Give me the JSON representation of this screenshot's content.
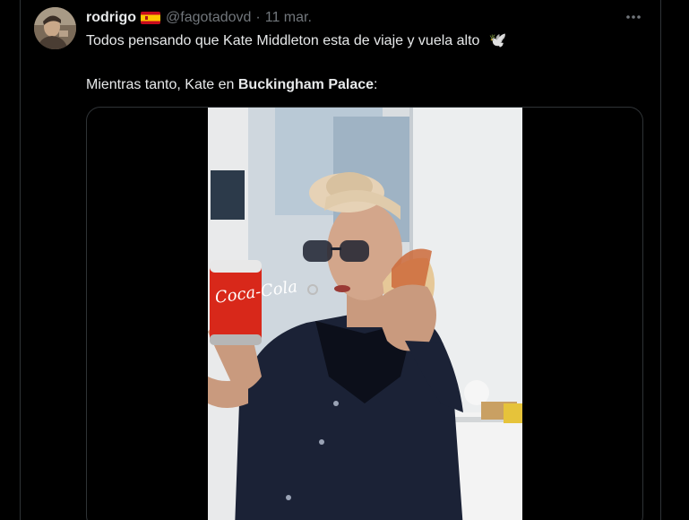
{
  "tweet": {
    "display_name": "rodrigo",
    "flag": "spain-flag",
    "handle": "@fagotadovd",
    "separator": "·",
    "time": "11 mar.",
    "more_icon": "more-icon",
    "text_line1": "Todos pensando que Kate Middleton esta de viaje y vuela alto",
    "text_line1_emoji": "🕊️",
    "text_line2_prefix": "Mientras tanto, Kate en ",
    "text_line2_bold": "Buckingham Palace",
    "text_line2_suffix": ":",
    "media": {
      "type": "video",
      "can_label": "Coca-Cola"
    }
  },
  "colors": {
    "background": "#000000",
    "text_primary": "#e7e9ea",
    "text_secondary": "#71767b",
    "border": "#2f3336"
  }
}
